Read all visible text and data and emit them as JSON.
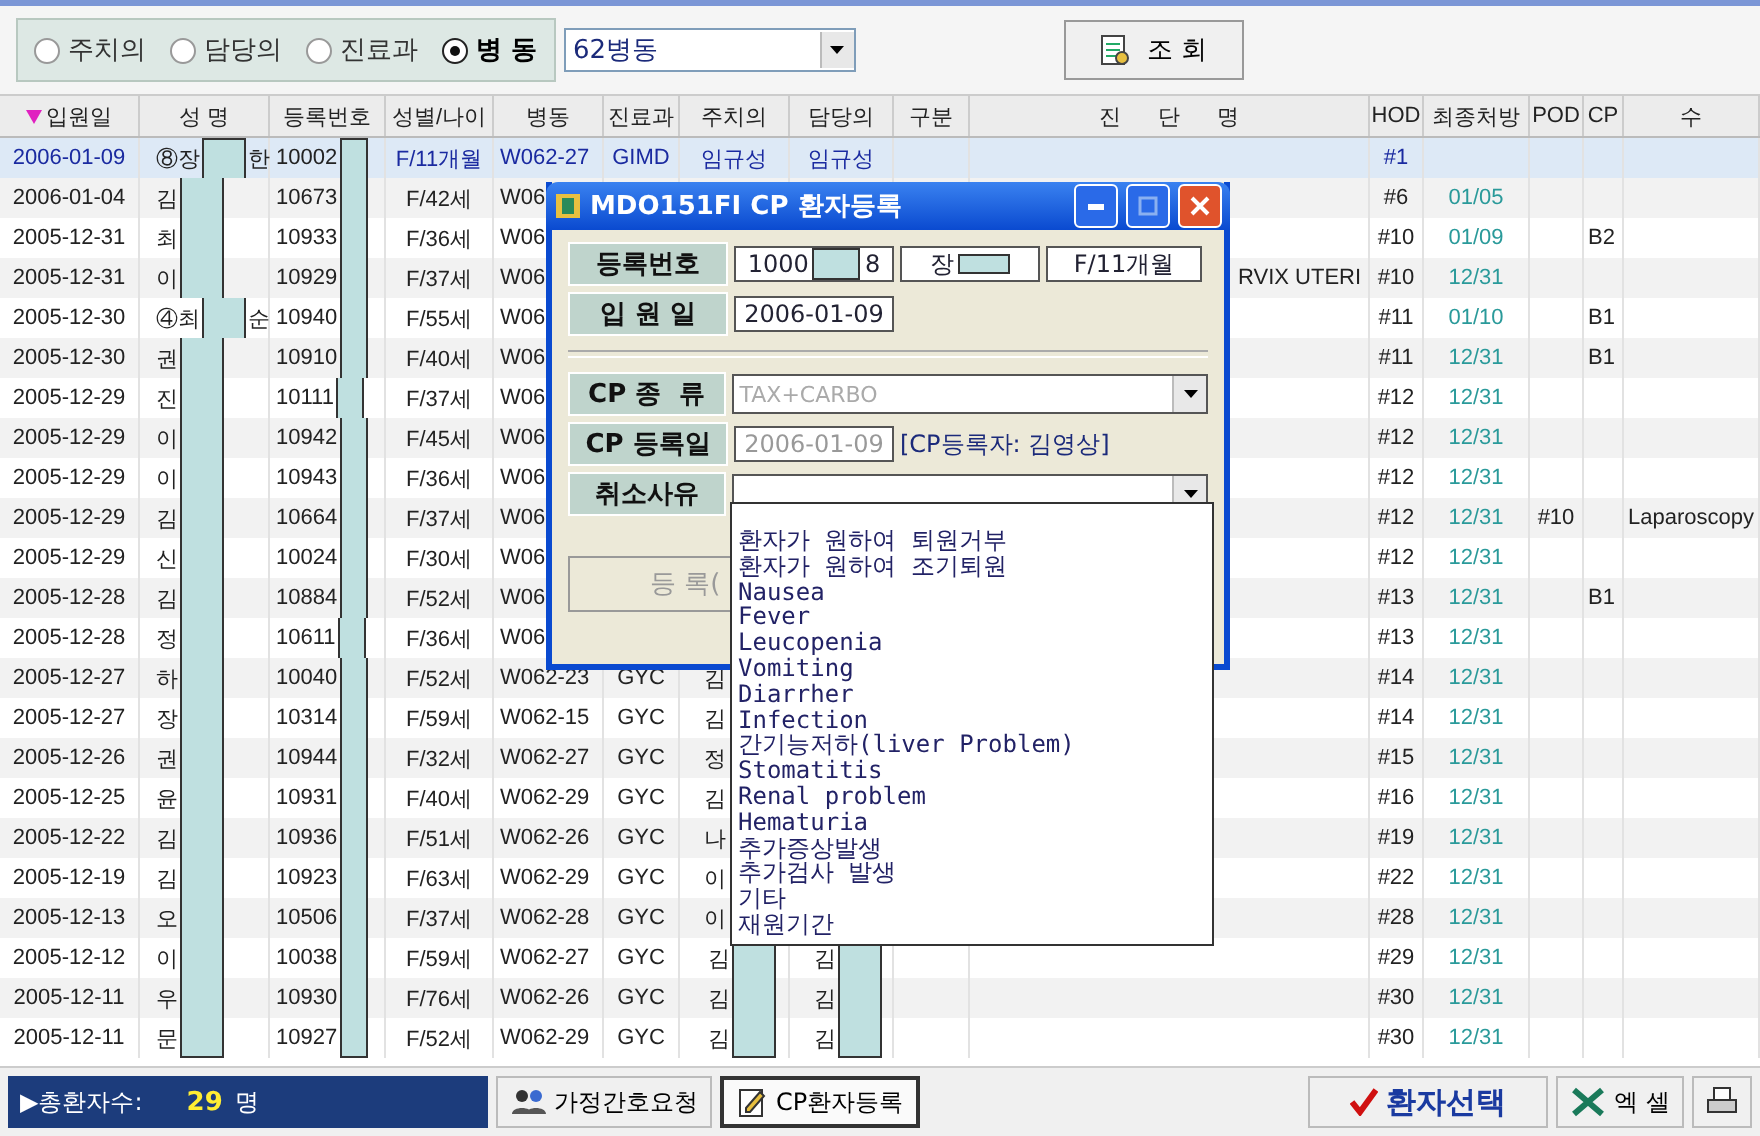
{
  "filter": {
    "options": [
      {
        "label": "주치의",
        "selected": false
      },
      {
        "label": "담당의",
        "selected": false
      },
      {
        "label": "진료과",
        "selected": false
      },
      {
        "label": "병 동",
        "selected": true
      }
    ],
    "ward": "62병동",
    "search_button": "조 회"
  },
  "table": {
    "columns": [
      "입원일",
      "성 명",
      "등록번호",
      "성별/나이",
      "병동",
      "진료과",
      "주치의",
      "담당의",
      "구분",
      "진      단      명",
      "HOD",
      "최종처방",
      "POD",
      "CP",
      "수"
    ],
    "rows": [
      {
        "admit": "2006-01-09",
        "name": "⑧장",
        "name_end": "한",
        "reg": "10002",
        "sex_age": "F/11개월",
        "ward": "W062-27",
        "dept": "GIMD",
        "attending": "임규성",
        "resident": "임규성",
        "hod": "#1",
        "selected": true
      },
      {
        "admit": "2006-01-04",
        "name": "김",
        "reg": "10673",
        "sex_age": "F/42세",
        "ward": "W06",
        "hod": "#6",
        "last_rx": "01/05",
        "selected": false
      },
      {
        "admit": "2005-12-31",
        "name": "최",
        "reg": "10933",
        "sex_age": "F/36세",
        "ward": "W06",
        "hod": "#10",
        "last_rx": "01/09",
        "cp": "B2",
        "selected": false
      },
      {
        "admit": "2005-12-31",
        "name": "이",
        "reg": "10929",
        "sex_age": "F/37세",
        "ward": "W06",
        "diagnosis": "RVIX UTERI",
        "hod": "#10",
        "last_rx": "12/31",
        "selected": false
      },
      {
        "admit": "2005-12-30",
        "name": "④최",
        "name_end": "순",
        "reg": "10940",
        "sex_age": "F/55세",
        "ward": "W06",
        "hod": "#11",
        "last_rx": "01/10",
        "cp": "B1",
        "selected": false
      },
      {
        "admit": "2005-12-30",
        "name": "권",
        "reg": "10910",
        "sex_age": "F/40세",
        "ward": "W06",
        "hod": "#11",
        "last_rx": "12/31",
        "cp": "B1",
        "selected": false
      },
      {
        "admit": "2005-12-29",
        "name": "진",
        "reg": "10111",
        "sex_age": "F/37세",
        "ward": "W06",
        "hod": "#12",
        "last_rx": "12/31",
        "selected": false
      },
      {
        "admit": "2005-12-29",
        "name": "이",
        "reg": "10942",
        "sex_age": "F/45세",
        "ward": "W06",
        "hod": "#12",
        "last_rx": "12/31",
        "selected": false
      },
      {
        "admit": "2005-12-29",
        "name": "이",
        "reg": "10943",
        "sex_age": "F/36세",
        "ward": "W06",
        "hod": "#12",
        "last_rx": "12/31",
        "selected": false
      },
      {
        "admit": "2005-12-29",
        "name": "김",
        "reg": "10664",
        "sex_age": "F/37세",
        "ward": "W06",
        "hod": "#12",
        "last_rx": "12/31",
        "pod": "#10",
        "surgery": "Laparoscopy",
        "selected": false
      },
      {
        "admit": "2005-12-29",
        "name": "신",
        "reg": "10024",
        "sex_age": "F/30세",
        "ward": "W06",
        "hod": "#12",
        "last_rx": "12/31",
        "selected": false
      },
      {
        "admit": "2005-12-28",
        "name": "김",
        "reg": "10884",
        "sex_age": "F/52세",
        "ward": "W06",
        "hod": "#13",
        "last_rx": "12/31",
        "cp": "B1",
        "selected": false
      },
      {
        "admit": "2005-12-28",
        "name": "정",
        "reg": "10611",
        "sex_age": "F/36세",
        "ward": "W06",
        "hod": "#13",
        "last_rx": "12/31",
        "selected": false
      },
      {
        "admit": "2005-12-27",
        "name": "하",
        "reg": "10040",
        "sex_age": "F/52세",
        "ward": "W062-23",
        "dept": "GYC",
        "attending": "김",
        "hod": "#14",
        "last_rx": "12/31",
        "selected": false
      },
      {
        "admit": "2005-12-27",
        "name": "장",
        "reg": "10314",
        "sex_age": "F/59세",
        "ward": "W062-15",
        "dept": "GYC",
        "attending": "김",
        "hod": "#14",
        "last_rx": "12/31",
        "selected": false
      },
      {
        "admit": "2005-12-26",
        "name": "권",
        "reg": "10944",
        "sex_age": "F/32세",
        "ward": "W062-27",
        "dept": "GYC",
        "attending": "정",
        "hod": "#15",
        "last_rx": "12/31",
        "selected": false
      },
      {
        "admit": "2005-12-25",
        "name": "윤",
        "reg": "10931",
        "sex_age": "F/40세",
        "ward": "W062-29",
        "dept": "GYC",
        "attending": "김",
        "hod": "#16",
        "last_rx": "12/31",
        "selected": false
      },
      {
        "admit": "2005-12-22",
        "name": "김",
        "reg": "10936",
        "sex_age": "F/51세",
        "ward": "W062-26",
        "dept": "GYC",
        "attending": "나",
        "hod": "#19",
        "last_rx": "12/31",
        "selected": false
      },
      {
        "admit": "2005-12-19",
        "name": "김",
        "reg": "10923",
        "sex_age": "F/63세",
        "ward": "W062-29",
        "dept": "GYC",
        "attending": "이",
        "hod": "#22",
        "last_rx": "12/31",
        "selected": false
      },
      {
        "admit": "2005-12-13",
        "name": "오",
        "reg": "10506",
        "sex_age": "F/37세",
        "ward": "W062-28",
        "dept": "GYC",
        "attending": "이",
        "hod": "#28",
        "last_rx": "12/31",
        "selected": false
      },
      {
        "admit": "2005-12-12",
        "name": "이",
        "reg": "10038",
        "sex_age": "F/59세",
        "ward": "W062-27",
        "dept": "GYC",
        "attending": "김",
        "resident": "김",
        "hod": "#29",
        "last_rx": "12/31",
        "selected": false
      },
      {
        "admit": "2005-12-11",
        "name": "우",
        "reg": "10930",
        "sex_age": "F/76세",
        "ward": "W062-26",
        "dept": "GYC",
        "attending": "김",
        "resident": "김",
        "hod": "#30",
        "last_rx": "12/31",
        "selected": false
      },
      {
        "admit": "2005-12-11",
        "name": "문",
        "reg": "10927",
        "sex_age": "F/52세",
        "ward": "W062-29",
        "dept": "GYC",
        "attending": "김",
        "resident": "김",
        "hod": "#30",
        "last_rx": "12/31",
        "selected": false
      }
    ]
  },
  "dialog": {
    "title": "MDO151FI CP 환자등록",
    "reg_label": "등록번호",
    "reg_start": "1000",
    "reg_end": "8",
    "patient_name": "장",
    "patient_age": "F/11개월",
    "admit_label": "입 원 일",
    "admit_date": "2006-01-09",
    "cp_type_label": "CP 종  류",
    "cp_type": "TAX+CARBO",
    "cp_date_label": "CP 등록일",
    "cp_date": "2006-01-09",
    "cp_registrar": "[CP등록자: 김영상]",
    "cancel_label": "취소사유",
    "register_button": "등 록(",
    "cancel_options": [
      "환자가 원하여 퇴원거부",
      "환자가 원하여 조기퇴원",
      "Nausea",
      "Fever",
      "Leucopenia",
      "Vomiting",
      "Diarrher",
      "Infection",
      "간기능저하(liver Problem)",
      "Stomatitis",
      "Renal problem",
      "Hematuria",
      "추가증상발생",
      "추가검사 발생",
      "기타",
      "재원기간"
    ]
  },
  "footer": {
    "total_label": "▶총환자수:",
    "total_count": "29",
    "total_unit": "명",
    "home_care_button": "가정간호요청",
    "cp_register_button": "CP환자등록",
    "select_button": "환자선택",
    "excel_button": "엑 셀"
  }
}
